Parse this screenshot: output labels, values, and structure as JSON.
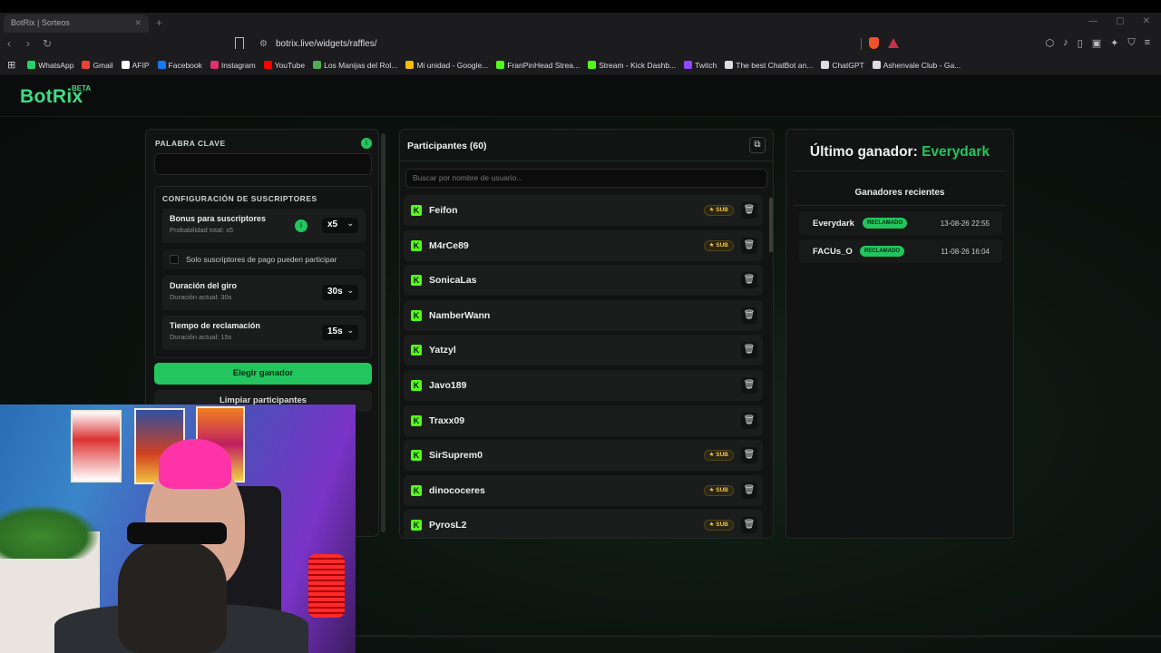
{
  "browser": {
    "tab_title": "BotRix | Sorteos",
    "url": "botrix.live/widgets/raffles/",
    "bookmarks": [
      {
        "label": "WhatsApp",
        "color": "#25d366"
      },
      {
        "label": "Gmail",
        "color": "#ea4335"
      },
      {
        "label": "AFIP",
        "color": "#ffffff"
      },
      {
        "label": "Facebook",
        "color": "#1877f2"
      },
      {
        "label": "Instagram",
        "color": "#e1306c"
      },
      {
        "label": "YouTube",
        "color": "#ff0000"
      },
      {
        "label": "Los Manijas del Rol...",
        "color": "#4caf50"
      },
      {
        "label": "Mi unidad - Google...",
        "color": "#fbbc04"
      },
      {
        "label": "FranPinHead Strea...",
        "color": "#53fc18"
      },
      {
        "label": "Stream - Kick Dashb...",
        "color": "#53fc18"
      },
      {
        "label": "Twitch",
        "color": "#9146ff"
      },
      {
        "label": "The best ChatBot an...",
        "color": "#dddddd"
      },
      {
        "label": "ChatGPT",
        "color": "#dddddd"
      },
      {
        "label": "Ashenvale Club - Ga...",
        "color": "#dddddd"
      }
    ]
  },
  "app": {
    "logo": "BotRix",
    "beta": "BETA",
    "accent": "#22c55e"
  },
  "settings": {
    "keyword_label": "PALABRA CLAVE",
    "keyword_value": "",
    "sub_config_label": "CONFIGURACIÓN DE SUSCRIPTORES",
    "bonus_title": "Bonus para suscriptores",
    "bonus_sub": "Probabilidad total: x5",
    "bonus_value": "x5",
    "only_subs_label": "Solo suscriptores de pago pueden participar",
    "spin_title": "Duración del giro",
    "spin_sub": "Duración actual: 30s",
    "spin_value": "30s",
    "claim_title": "Tiempo de reclamación",
    "claim_sub": "Duración actual: 15s",
    "claim_value": "15s",
    "pick_winner": "Elegir ganador",
    "clear_participants": "Limpiar participantes"
  },
  "participants": {
    "title": "Participantes (60)",
    "search_placeholder": "Buscar por nombre de usuario...",
    "sub_badge": "SUB",
    "items": [
      {
        "name": "Feifon",
        "sub": true
      },
      {
        "name": "M4rCe89",
        "sub": true
      },
      {
        "name": "SonicaLas",
        "sub": false
      },
      {
        "name": "NamberWann",
        "sub": false
      },
      {
        "name": "Yatzyl",
        "sub": false
      },
      {
        "name": "Javo189",
        "sub": false
      },
      {
        "name": "Traxx09",
        "sub": false
      },
      {
        "name": "SirSuprem0",
        "sub": true
      },
      {
        "name": "dinococeres",
        "sub": true
      },
      {
        "name": "PyrosL2",
        "sub": true
      }
    ]
  },
  "winners": {
    "last_label": "Último ganador:",
    "last_name": "Everydark",
    "recent_title": "Ganadores recientes",
    "claimed_label": "RECLAMADO",
    "recent": [
      {
        "name": "Everydark",
        "date": "13-08-26 22:55"
      },
      {
        "name": "FACUs_O",
        "date": "11-08-26 16:04"
      }
    ]
  }
}
